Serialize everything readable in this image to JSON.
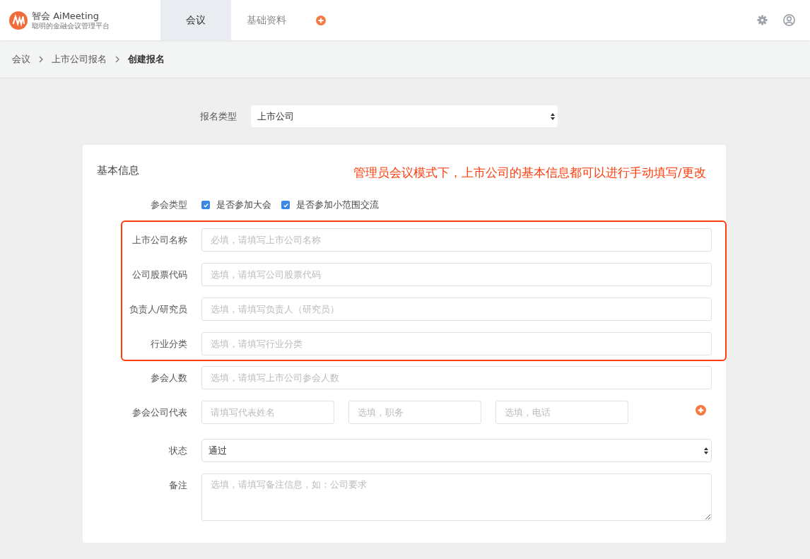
{
  "header": {
    "logo": {
      "title": "智会 AiMeeting",
      "subtitle": "聪明的金融会议管理平台"
    },
    "tabs": [
      {
        "label": "会议",
        "selected": true
      },
      {
        "label": "基础资料",
        "selected": false
      }
    ]
  },
  "breadcrumb": [
    {
      "label": "会议",
      "current": false
    },
    {
      "label": "上市公司报名",
      "current": false
    },
    {
      "label": "创建报名",
      "current": true
    }
  ],
  "registration_type": {
    "label": "报名类型",
    "value": "上市公司"
  },
  "basic_info": {
    "title": "基本信息",
    "annotation": "管理员会议模式下，上市公司的基本信息都可以进行手动填写/更改",
    "participation": {
      "label": "参会类型",
      "options": [
        {
          "label": "是否参加大会",
          "checked": true
        },
        {
          "label": "是否参加小范围交流",
          "checked": true
        }
      ]
    },
    "fields": [
      {
        "label": "上市公司名称",
        "placeholder": "必填，请填写上市公司名称",
        "highlighted": true
      },
      {
        "label": "公司股票代码",
        "placeholder": "选填，请填写公司股票代码",
        "highlighted": true
      },
      {
        "label": "负责人/研究员",
        "placeholder": "选填，请填写负责人（研究员）",
        "highlighted": true
      },
      {
        "label": "行业分类",
        "placeholder": "选填，请填写行业分类",
        "highlighted": true
      },
      {
        "label": "参会人数",
        "placeholder": "选填，请填写上市公司参会人数",
        "highlighted": false
      }
    ],
    "representatives": {
      "label": "参会公司代表",
      "placeholders": [
        "请填写代表姓名",
        "选填，职务",
        "选填，电话"
      ]
    },
    "status": {
      "label": "状态",
      "value": "通过"
    },
    "remarks": {
      "label": "备注",
      "placeholder": "选填，请填写备注信息，如：公司要求"
    }
  }
}
